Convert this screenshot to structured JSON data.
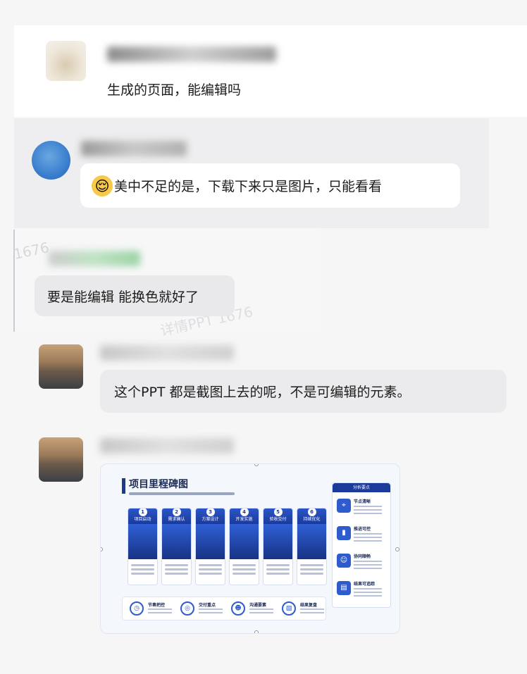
{
  "messages": [
    {
      "text": "生成的页面，能编辑吗"
    },
    {
      "emoji": "😌",
      "text": "美中不足的是，下载下来只是图片，只能看看"
    },
    {
      "text": "要是能编辑 能换色就好了"
    },
    {
      "text": "这个PPT 都是截图上去的呢，不是可编辑的元素。"
    }
  ],
  "watermarks": [
    "1676",
    "详情PPT 1676"
  ],
  "slide": {
    "title": "项目里程碑图",
    "phases": [
      {
        "num": "1",
        "label": "项目启动"
      },
      {
        "num": "2",
        "label": "需求确认"
      },
      {
        "num": "3",
        "label": "方案设计"
      },
      {
        "num": "4",
        "label": "开发实施"
      },
      {
        "num": "5",
        "label": "验收交付"
      },
      {
        "num": "6",
        "label": "持续优化"
      }
    ],
    "side_title": "分析要点",
    "side_items": [
      {
        "icon": "pin-icon",
        "glyph": "⌖",
        "label": "节点清晰"
      },
      {
        "icon": "chart-icon",
        "glyph": "▮",
        "label": "推进可控"
      },
      {
        "icon": "team-icon",
        "glyph": "☺",
        "label": "协同顺畅"
      },
      {
        "icon": "doc-icon",
        "glyph": "▤",
        "label": "结果可追踪"
      }
    ],
    "bottom_items": [
      {
        "icon": "clock-icon",
        "glyph": "◷",
        "label": "节奏把控"
      },
      {
        "icon": "target-icon",
        "glyph": "◎",
        "label": "交付重点"
      },
      {
        "icon": "people-icon",
        "glyph": "☻",
        "label": "沟通要素"
      },
      {
        "icon": "clipboard-icon",
        "glyph": "▧",
        "label": "结果复盘"
      }
    ]
  },
  "colors": {
    "accent": "#1b3a9a",
    "bubble": "#ffffff",
    "bubble_gray": "#e9e9eb"
  }
}
